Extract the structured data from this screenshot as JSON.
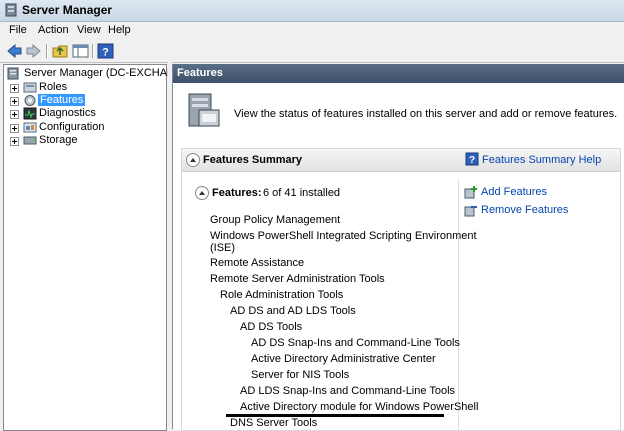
{
  "window": {
    "title": "Server Manager"
  },
  "menu": [
    "File",
    "Action",
    "View",
    "Help"
  ],
  "toolbar": {
    "icons": [
      "back-arrow-icon",
      "forward-arrow-icon",
      "up-folder-icon",
      "show-hide-tree-icon",
      "help-icon"
    ]
  },
  "tree": {
    "root": "Server Manager (DC-EXCHANGE)",
    "items": [
      "Roles",
      "Features",
      "Diagnostics",
      "Configuration",
      "Storage"
    ],
    "selected": "Features"
  },
  "main": {
    "header": "Features",
    "intro": "View the status of features installed on this server and add or remove features.",
    "summary": {
      "title": "Features Summary",
      "help_link": "Features Summary Help"
    },
    "features": {
      "title": "Features:",
      "count": "6 of 41 installed",
      "actions": [
        "Add Features",
        "Remove Features"
      ],
      "items": [
        {
          "label": "Group Policy Management",
          "level": 0
        },
        {
          "label": "Windows PowerShell Integrated Scripting Environment",
          "level": 0
        },
        {
          "label": "(ISE)",
          "level": 0
        },
        {
          "label": "Remote Assistance",
          "level": 0
        },
        {
          "label": "Remote Server Administration Tools",
          "level": 0
        },
        {
          "label": "Role Administration Tools",
          "level": 1
        },
        {
          "label": "AD DS and AD LDS Tools",
          "level": 2
        },
        {
          "label": "AD DS Tools",
          "level": 3
        },
        {
          "label": "AD DS Snap-Ins and Command-Line Tools",
          "level": 4
        },
        {
          "label": "Active Directory Administrative Center",
          "level": 4
        },
        {
          "label": "Server for NIS Tools",
          "level": 4
        },
        {
          "label": "AD LDS Snap-Ins and Command-Line Tools",
          "level": 3
        },
        {
          "label": "Active Directory module for Windows PowerShell",
          "level": 3
        },
        {
          "label": "DNS Server Tools",
          "level": 2
        }
      ]
    }
  },
  "colors": {
    "header_bg": "#4a5d78",
    "link": "#0645ad",
    "selected": "#3399ff"
  }
}
